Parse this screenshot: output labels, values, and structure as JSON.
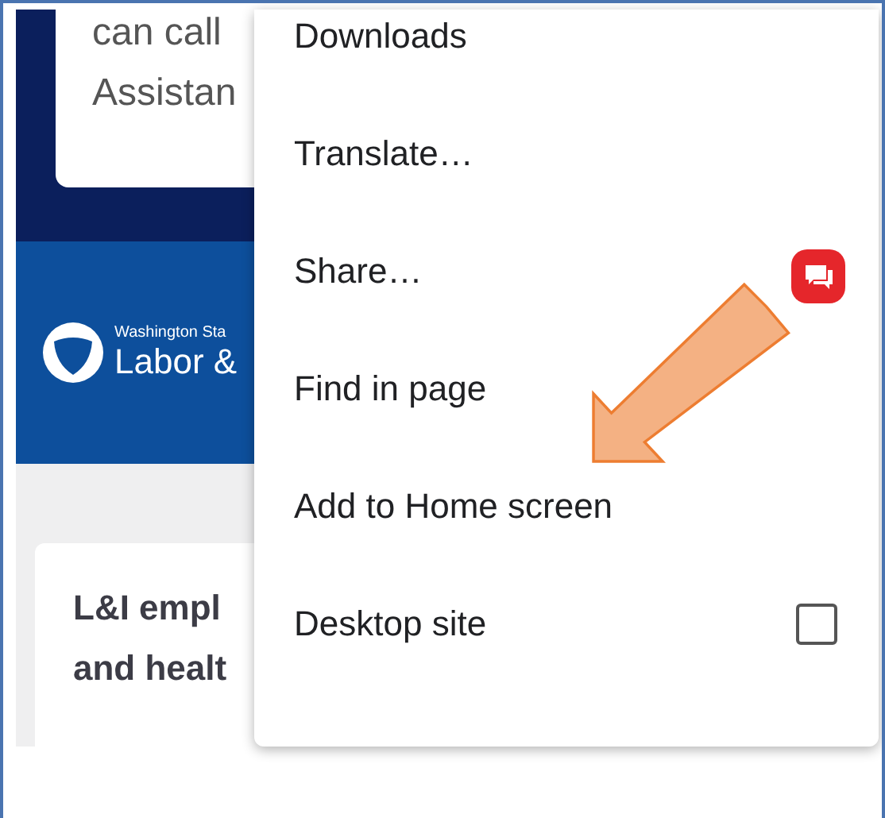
{
  "page": {
    "card_lines": [
      "can call",
      "Assistan"
    ],
    "banner": {
      "agency_line": "Washington Sta",
      "name": "Labor &"
    },
    "article": {
      "heading_lines": [
        "L&I empl",
        "and healt"
      ]
    }
  },
  "menu": {
    "items": [
      {
        "label": "Downloads",
        "kind": "plain"
      },
      {
        "label": "Translate…",
        "kind": "plain"
      },
      {
        "label": "Share…",
        "kind": "plain"
      },
      {
        "label": "Find in page",
        "kind": "plain"
      },
      {
        "label": "Add to Home screen",
        "kind": "plain"
      },
      {
        "label": "Desktop site",
        "kind": "checkbox",
        "checked": false
      }
    ]
  }
}
